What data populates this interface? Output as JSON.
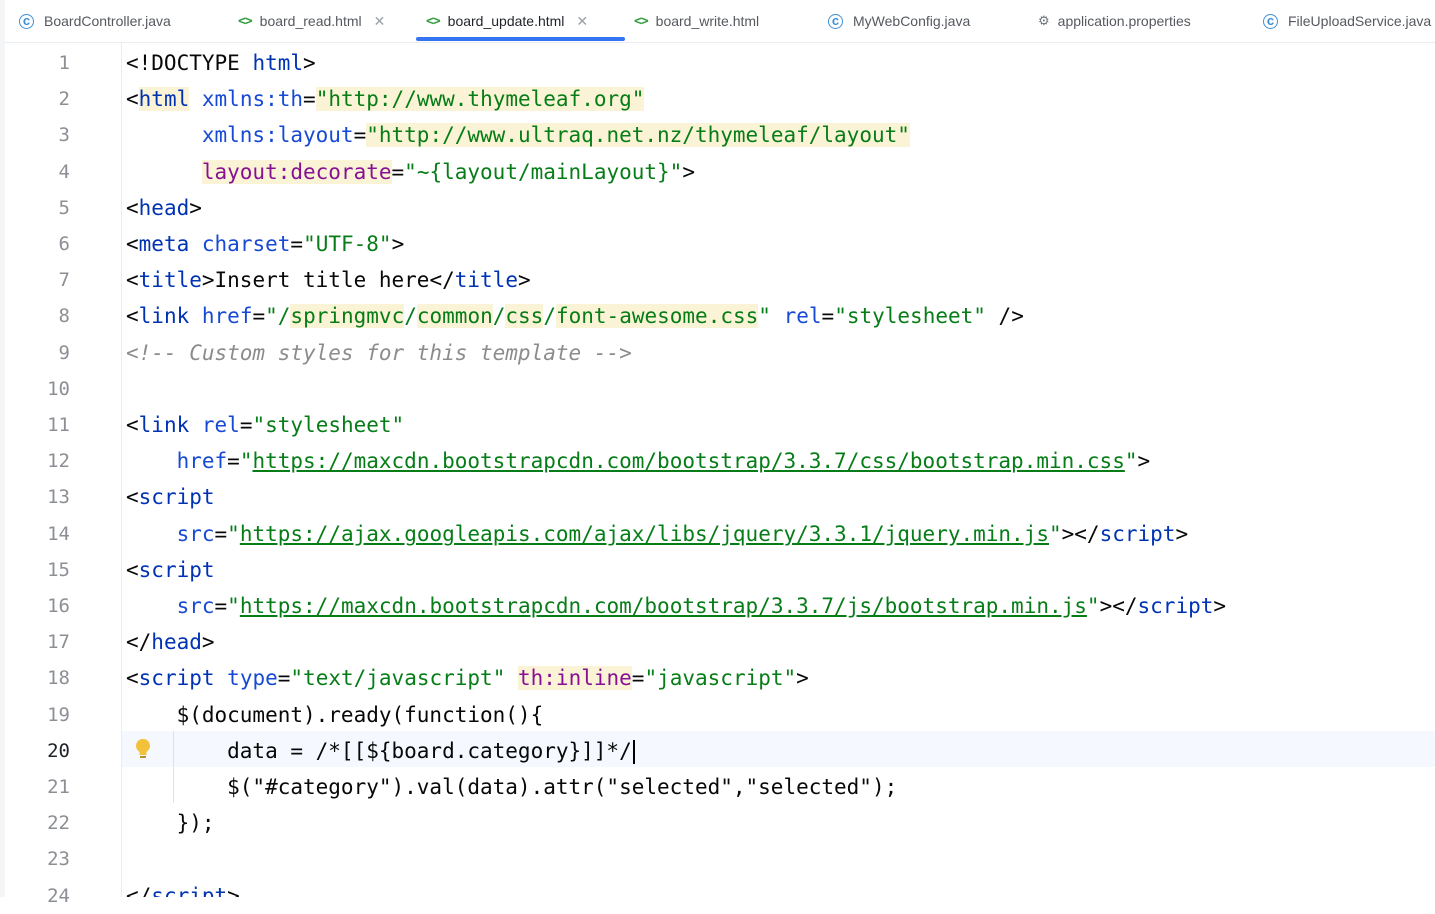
{
  "tabs": [
    {
      "label": "BoardController.java",
      "icon": "java-class-icon",
      "active": false,
      "closable": false
    },
    {
      "label": "board_read.html",
      "icon": "html-file-icon",
      "active": false,
      "closable": true
    },
    {
      "label": "board_update.html",
      "icon": "html-file-icon",
      "active": true,
      "closable": true
    },
    {
      "label": "board_write.html",
      "icon": "html-file-icon",
      "active": false,
      "closable": false
    },
    {
      "label": "MyWebConfig.java",
      "icon": "java-class-icon",
      "active": false,
      "closable": false
    },
    {
      "label": "application.properties",
      "icon": "gear-icon",
      "active": false,
      "closable": false
    },
    {
      "label": "FileUploadService.java",
      "icon": "java-class-icon",
      "active": false,
      "closable": false
    }
  ],
  "editor": {
    "current_line": 20,
    "lines": [
      {
        "n": "1",
        "parts": [
          [
            "<!DOCTYPE ",
            ""
          ],
          [
            "html",
            "tg"
          ],
          [
            ">",
            ""
          ]
        ]
      },
      {
        "n": "2",
        "parts": [
          [
            "<",
            ""
          ],
          [
            "html",
            "tg hl"
          ],
          [
            " ",
            ""
          ],
          [
            "xmlns:th",
            "at"
          ],
          [
            "=",
            ""
          ],
          [
            "\"http://www.thymeleaf.org\"",
            "st hl"
          ]
        ]
      },
      {
        "n": "3",
        "parts": [
          [
            "      ",
            ""
          ],
          [
            "xmlns:layout",
            "at"
          ],
          [
            "=",
            ""
          ],
          [
            "\"http://www.ultraq.net.nz/thymeleaf/layout\"",
            "st hl"
          ]
        ]
      },
      {
        "n": "4",
        "parts": [
          [
            "      ",
            ""
          ],
          [
            "layout:decorate",
            "th hl"
          ],
          [
            "=",
            ""
          ],
          [
            "\"~{layout/mainLayout}\"",
            "st"
          ],
          [
            ">",
            ""
          ]
        ]
      },
      {
        "n": "5",
        "parts": [
          [
            "<",
            ""
          ],
          [
            "head",
            "tg"
          ],
          [
            ">",
            ""
          ]
        ]
      },
      {
        "n": "6",
        "parts": [
          [
            "<",
            ""
          ],
          [
            "meta",
            "tg"
          ],
          [
            " ",
            ""
          ],
          [
            "charset",
            "at"
          ],
          [
            "=",
            ""
          ],
          [
            "\"UTF-8\"",
            "st"
          ],
          [
            ">",
            ""
          ]
        ]
      },
      {
        "n": "7",
        "parts": [
          [
            "<",
            ""
          ],
          [
            "title",
            "tg"
          ],
          [
            ">Insert title here</",
            ""
          ],
          [
            "title",
            "tg"
          ],
          [
            ">",
            ""
          ]
        ]
      },
      {
        "n": "8",
        "parts": [
          [
            "<",
            ""
          ],
          [
            "link",
            "tg"
          ],
          [
            " ",
            ""
          ],
          [
            "href",
            "at"
          ],
          [
            "=",
            ""
          ],
          [
            "\"/",
            "st"
          ],
          [
            "springmvc",
            "st hl"
          ],
          [
            "/",
            "st"
          ],
          [
            "common",
            "st hl"
          ],
          [
            "/",
            "st"
          ],
          [
            "css",
            "st hl"
          ],
          [
            "/",
            "st"
          ],
          [
            "font-awesome.css",
            "st hl"
          ],
          [
            "\"",
            "st"
          ],
          [
            " ",
            ""
          ],
          [
            "rel",
            "at"
          ],
          [
            "=",
            ""
          ],
          [
            "\"stylesheet\"",
            "st"
          ],
          [
            " />",
            ""
          ]
        ]
      },
      {
        "n": "9",
        "parts": [
          [
            "<!-- Custom styles for this template -->",
            "cm"
          ]
        ]
      },
      {
        "n": "10",
        "parts": []
      },
      {
        "n": "11",
        "parts": [
          [
            "<",
            ""
          ],
          [
            "link",
            "tg"
          ],
          [
            " ",
            ""
          ],
          [
            "rel",
            "at"
          ],
          [
            "=",
            ""
          ],
          [
            "\"stylesheet\"",
            "st"
          ]
        ]
      },
      {
        "n": "12",
        "parts": [
          [
            "    ",
            ""
          ],
          [
            "href",
            "at"
          ],
          [
            "=",
            ""
          ],
          [
            "\"",
            "st"
          ],
          [
            "https://maxcdn.bootstrapcdn.com/bootstrap/3.3.7/css/bootstrap.min.css",
            "st ul"
          ],
          [
            "\"",
            "st"
          ],
          [
            ">",
            ""
          ]
        ]
      },
      {
        "n": "13",
        "parts": [
          [
            "<",
            ""
          ],
          [
            "script",
            "tg"
          ]
        ]
      },
      {
        "n": "14",
        "parts": [
          [
            "    ",
            ""
          ],
          [
            "src",
            "at"
          ],
          [
            "=",
            ""
          ],
          [
            "\"",
            "st"
          ],
          [
            "https://ajax.googleapis.com/ajax/libs/jquery/3.3.1/jquery.min.js",
            "st ul"
          ],
          [
            "\"",
            "st"
          ],
          [
            "></",
            ""
          ],
          [
            "script",
            "tg"
          ],
          [
            ">",
            ""
          ]
        ]
      },
      {
        "n": "15",
        "parts": [
          [
            "<",
            ""
          ],
          [
            "script",
            "tg"
          ]
        ]
      },
      {
        "n": "16",
        "parts": [
          [
            "    ",
            ""
          ],
          [
            "src",
            "at"
          ],
          [
            "=",
            ""
          ],
          [
            "\"",
            "st"
          ],
          [
            "https://maxcdn.bootstrapcdn.com/bootstrap/3.3.7/js/bootstrap.min.js",
            "st ul"
          ],
          [
            "\"",
            "st"
          ],
          [
            "></",
            ""
          ],
          [
            "script",
            "tg"
          ],
          [
            ">",
            ""
          ]
        ]
      },
      {
        "n": "17",
        "parts": [
          [
            "</",
            ""
          ],
          [
            "head",
            "tg"
          ],
          [
            ">",
            ""
          ]
        ]
      },
      {
        "n": "18",
        "parts": [
          [
            "<",
            ""
          ],
          [
            "script",
            "tg"
          ],
          [
            " ",
            ""
          ],
          [
            "type",
            "at"
          ],
          [
            "=",
            ""
          ],
          [
            "\"text/javascript\"",
            "st"
          ],
          [
            " ",
            ""
          ],
          [
            "th:inline",
            "th hl"
          ],
          [
            "=",
            ""
          ],
          [
            "\"javascript\"",
            "st"
          ],
          [
            ">",
            ""
          ]
        ]
      },
      {
        "n": "19",
        "parts": [
          [
            "    $(document).ready(function(){",
            ""
          ]
        ]
      },
      {
        "n": "20",
        "parts": [
          [
            "        data = /*[[${board.category}]]*/",
            ""
          ]
        ]
      },
      {
        "n": "21",
        "parts": [
          [
            "        $(\"#category\").val(data).attr(\"selected\",\"selected\");",
            ""
          ]
        ]
      },
      {
        "n": "22",
        "parts": [
          [
            "    });",
            ""
          ]
        ]
      },
      {
        "n": "23",
        "parts": []
      },
      {
        "n": "24",
        "parts": [
          [
            "</",
            ""
          ],
          [
            "script",
            "tg"
          ],
          [
            ">",
            ""
          ]
        ]
      }
    ]
  }
}
